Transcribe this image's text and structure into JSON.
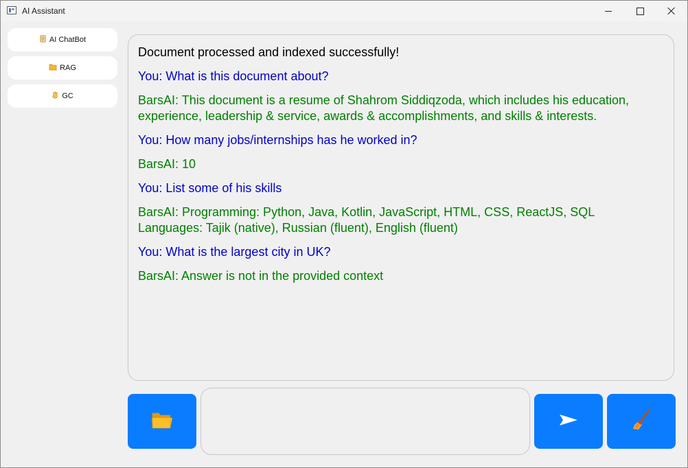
{
  "window": {
    "title": "AI Assistant"
  },
  "sidebar": {
    "items": [
      {
        "label": "AI ChatBot",
        "icon": "scroll-icon"
      },
      {
        "label": "RAG",
        "icon": "folder-icon"
      },
      {
        "label": "GC",
        "icon": "hand-icon"
      }
    ]
  },
  "chat": {
    "messages": [
      {
        "role": "system",
        "text": "Document processed and indexed successfully!"
      },
      {
        "role": "user",
        "text": "You: What is this document about?"
      },
      {
        "role": "bot",
        "text": "BarsAI: This document is a resume of Shahrom Siddiqzoda, which includes his education, experience, leadership & service, awards & accomplishments, and skills & interests."
      },
      {
        "role": "user",
        "text": "You: How many jobs/internships has he worked in?"
      },
      {
        "role": "bot",
        "text": "BarsAI: 10"
      },
      {
        "role": "user",
        "text": "You: List some of his skills"
      },
      {
        "role": "bot",
        "text": "BarsAI: Programming: Python, Java, Kotlin, JavaScript, HTML, CSS, ReactJS, SQL\nLanguages: Tajik (native), Russian (fluent), English (fluent)"
      },
      {
        "role": "user",
        "text": "You: What is the largest city in UK?"
      },
      {
        "role": "bot",
        "text": "BarsAI: Answer is not in the provided context"
      }
    ]
  },
  "composer": {
    "value": "",
    "placeholder": "",
    "upload_icon": "folder-open-icon",
    "send_icon": "send-arrow-icon",
    "clear_icon": "broom-icon"
  },
  "colors": {
    "accent": "#0a7cff",
    "user_text": "#0000cc",
    "bot_text": "#008000",
    "system_text": "#000000"
  }
}
